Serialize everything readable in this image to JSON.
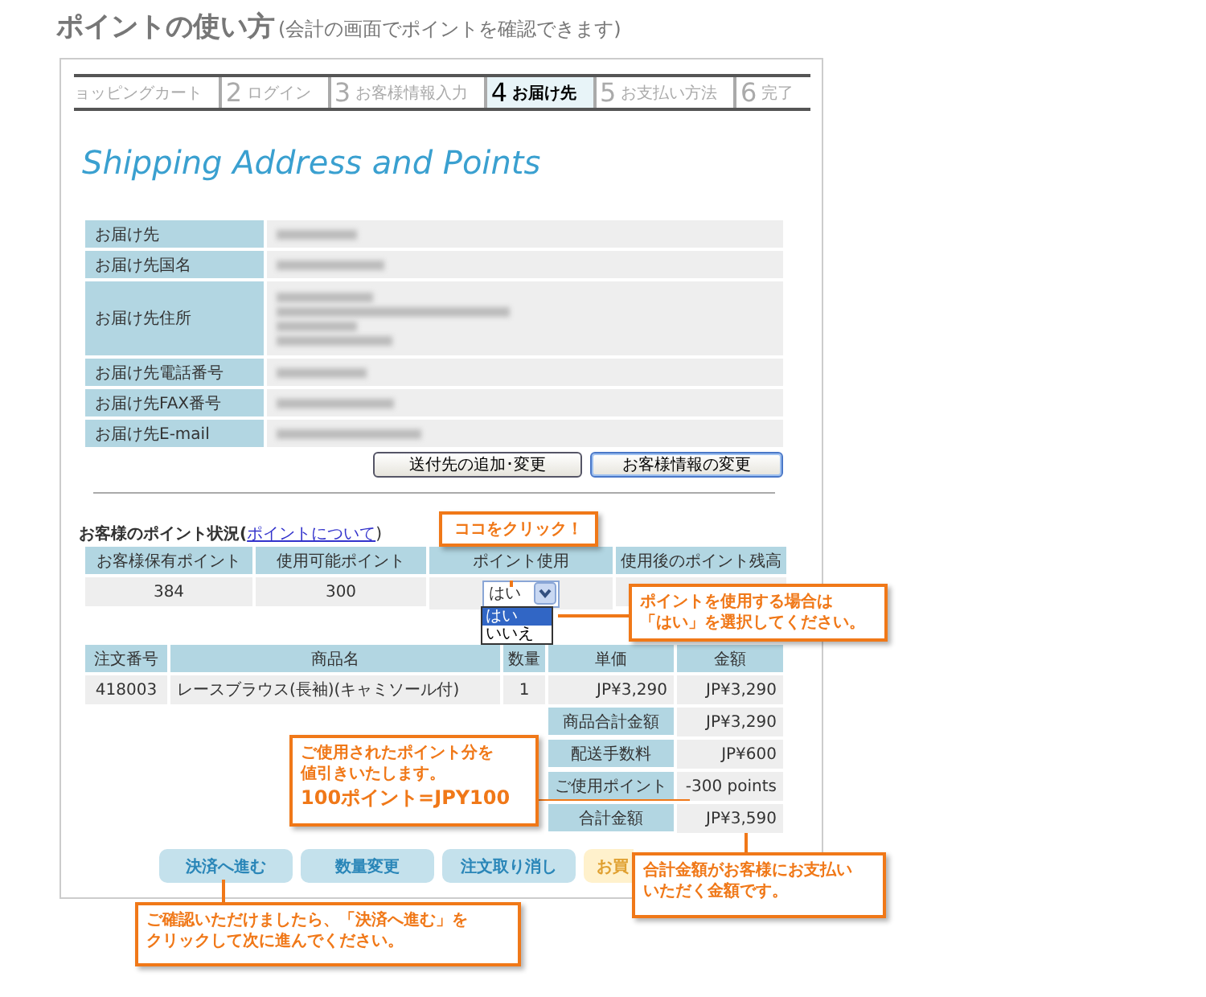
{
  "page_title": "ポイントの使い方",
  "page_subtitle": "(会計の画面でポイントを確認できます)",
  "steps": [
    {
      "label": "ョッピングカート",
      "selected": false
    },
    {
      "number": "2",
      "label": "ログイン",
      "selected": false
    },
    {
      "number": "3",
      "label": "お客様情報入力",
      "selected": false
    },
    {
      "number": "4",
      "label": "お届け先",
      "selected": true
    },
    {
      "number": "5",
      "label": "お支払い方法",
      "selected": false
    },
    {
      "number": "6",
      "label": "完了",
      "selected": false
    }
  ],
  "heading": "Shipping Address and Points",
  "address_rows": [
    {
      "label": "お届け先",
      "kind": "single"
    },
    {
      "label": "お届け先国名",
      "kind": "single"
    },
    {
      "label": "お届け先住所",
      "kind": "multi"
    },
    {
      "label": "お届け先電話番号",
      "kind": "single"
    },
    {
      "label": "お届け先FAX番号",
      "kind": "single"
    },
    {
      "label": "お届け先E-mail",
      "kind": "single"
    }
  ],
  "address_buttons": [
    "送付先の追加･変更",
    "お客様情報の変更"
  ],
  "points": {
    "title": "お客様のポイント状況(",
    "link": "ポイントについて",
    "close": ")",
    "columns": [
      "お客様保有ポイント",
      "使用可能ポイント",
      "ポイント使用",
      "使用後のポイント残高"
    ],
    "values": [
      "384",
      "300"
    ],
    "select": {
      "value": "はい",
      "options": [
        {
          "label": "はい",
          "selected": true
        },
        {
          "label": "いいえ",
          "selected": false
        }
      ]
    }
  },
  "order": {
    "columns": [
      "注文番号",
      "商品名",
      "数量",
      "単価",
      "金額"
    ],
    "rows": [
      [
        "418003",
        "レースブラウス(長袖)(キャミソール付)",
        "1",
        "JP¥3,290",
        "JP¥3,290"
      ]
    ],
    "totals": [
      {
        "label": "商品合計金額",
        "value": "JP¥3,290"
      },
      {
        "label": "配送手数料",
        "value": "JP¥600"
      },
      {
        "label": "ご使用ポイント",
        "value": "-300 points"
      },
      {
        "label": "合計金額",
        "value": "JP¥3,590"
      }
    ]
  },
  "actions": [
    {
      "label": "決済へ進む",
      "kind": "main"
    },
    {
      "label": "数量変更",
      "kind": "main"
    },
    {
      "label": "注文取り消し",
      "kind": "main"
    },
    {
      "label": "お買",
      "kind": "shop"
    }
  ],
  "callouts": [
    {
      "lines": [
        "ココをクリック！"
      ]
    },
    {
      "lines": [
        "ポイントを使用する場合は",
        "「はい」を選択してください。"
      ]
    },
    {
      "lines": [
        "ご使用されたポイント分を",
        "値引きいたします。"
      ],
      "note": "100ポイント=JPY100"
    },
    {
      "lines": [
        "合計金額がお客様にお支払い",
        "いただく金額です。"
      ]
    },
    {
      "lines": [
        "ご確認いただけましたら、「決済へ進む」を",
        "クリックして次に進んでください。"
      ]
    }
  ]
}
